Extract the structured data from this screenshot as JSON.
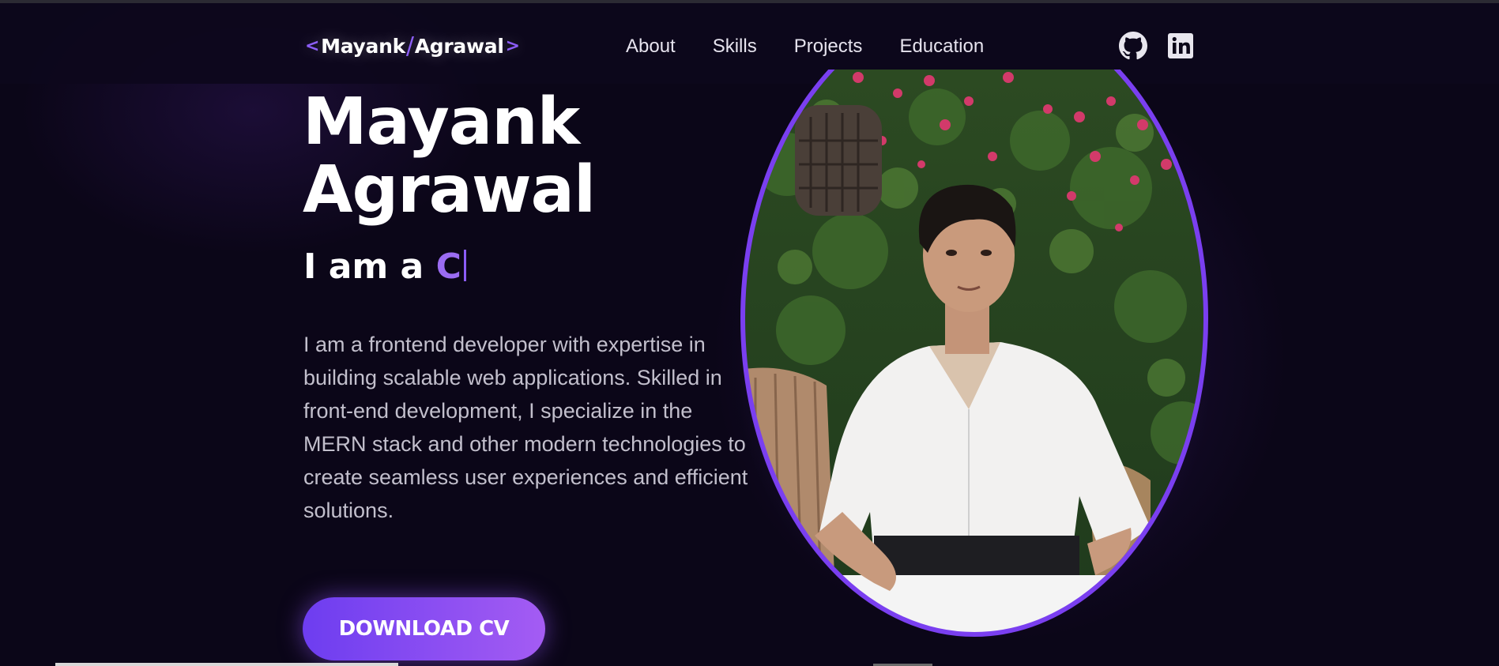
{
  "nav": {
    "logo": {
      "open_bracket": "<",
      "first": "Mayank",
      "slash": "/",
      "last": "Agrawal",
      "close_bracket": ">"
    },
    "links": [
      "About",
      "Skills",
      "Projects",
      "Education"
    ],
    "social": [
      {
        "icon": "github-icon"
      },
      {
        "icon": "linkedin-icon"
      }
    ]
  },
  "hero": {
    "name_line1": "Mayank",
    "name_line2": "Agrawal",
    "typed_prefix": "I am a",
    "typed_text": "C",
    "description": "I am a frontend developer with expertise in building scalable web applications. Skilled in front-end development, I specialize in the MERN stack and other modern technologies to create seamless user experiences and efficient solutions.",
    "cv_button": "DOWNLOAD CV"
  },
  "colors": {
    "background": "#0b0618",
    "accent": "#8b5cf6",
    "button_gradient_start": "#6d3df0",
    "button_gradient_end": "#a45cf3"
  }
}
